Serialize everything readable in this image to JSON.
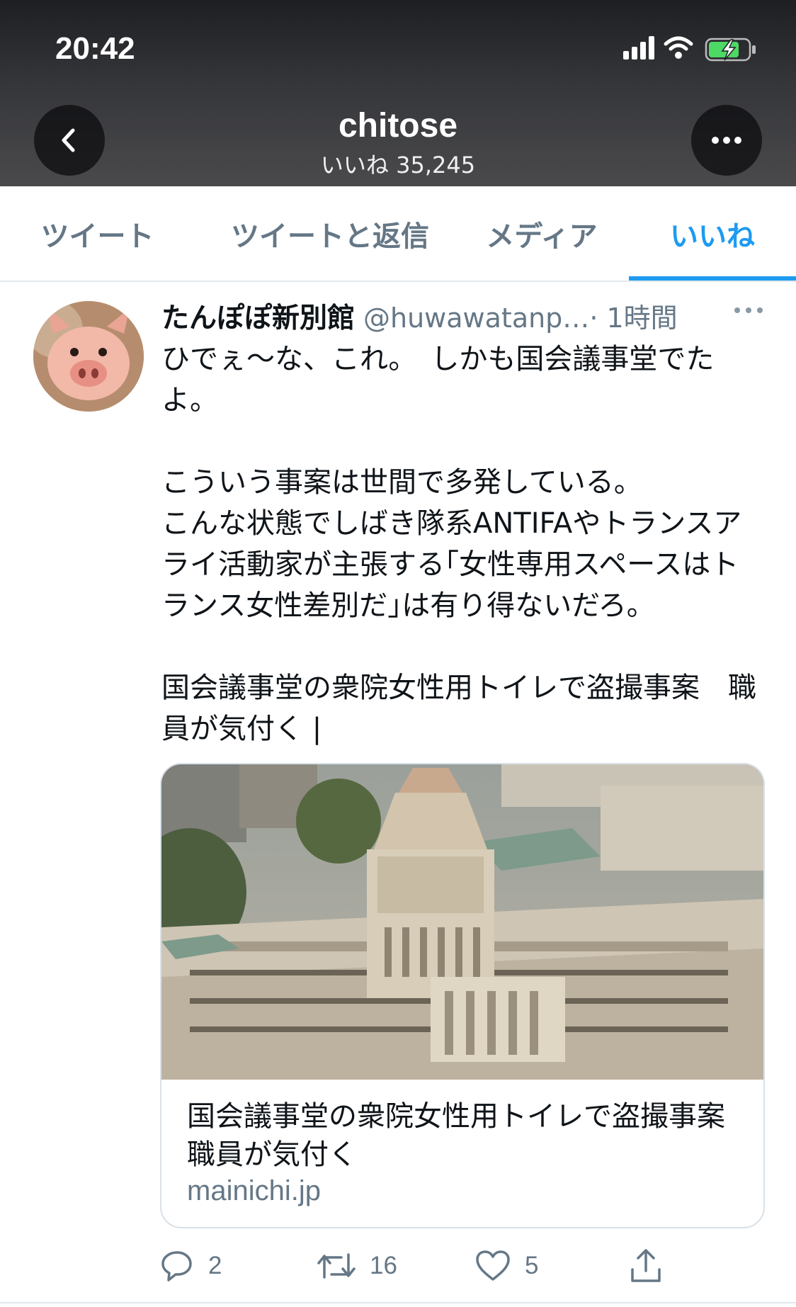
{
  "status_bar": {
    "time": "20:42"
  },
  "header": {
    "title": "chitose",
    "subtitle": "いいね 35,245"
  },
  "tabs": [
    {
      "label": "ツイート",
      "active": false
    },
    {
      "label": "ツイートと返信",
      "active": false
    },
    {
      "label": "メディア",
      "active": false
    },
    {
      "label": "いいね",
      "active": true
    }
  ],
  "tweet": {
    "author_name": "たんぽぽ新別館",
    "handle": "@huwawatanp…",
    "time": "· 1時間",
    "text": "ひでぇ〜な、これ。　しかも国会議事堂でたよ。\n\nこういう事案は世間で多発している。\nこんな状態でしばき隊系ANTIFAやトランスアライ活動家が主張する｢女性専用スペースはトランス女性差別だ｣は有り得ないだろ。\n\n国会議事堂の衆院女性用トイレで盗撮事案　職員が気付く |",
    "card": {
      "title": "国会議事堂の衆院女性用トイレで盗撮事案　職員が気付く",
      "domain": "mainichi.jp"
    },
    "actions": {
      "replies": "2",
      "retweets": "16",
      "likes": "5"
    }
  },
  "colors": {
    "accent": "#1d9bf0",
    "secondary_text": "#657786",
    "divider": "#e1e8ed"
  }
}
